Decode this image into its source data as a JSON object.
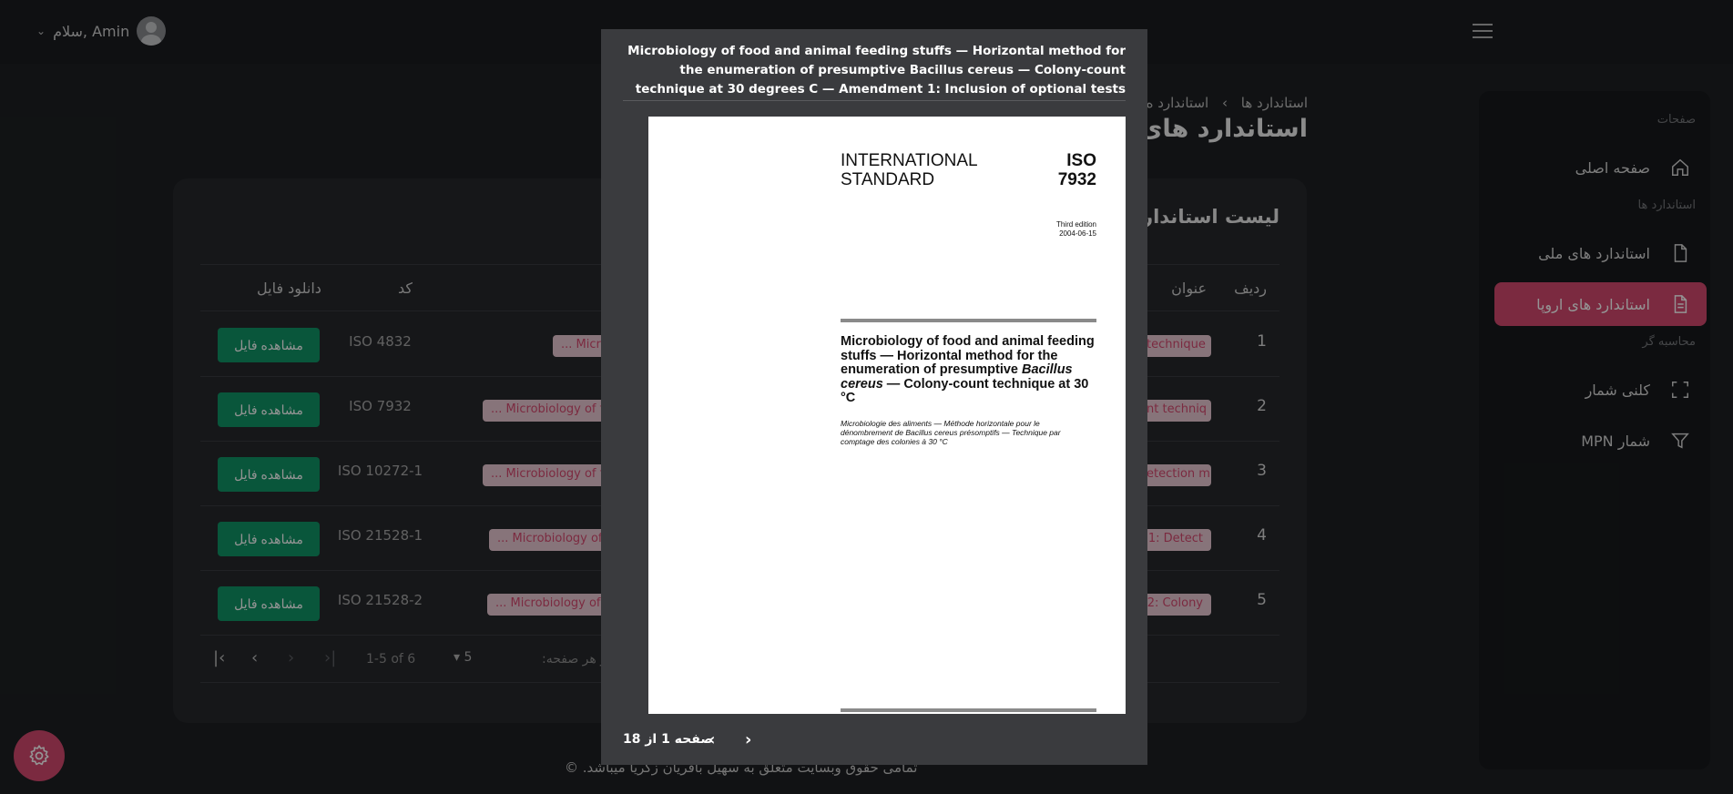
{
  "topbar": {
    "user_greeting": "سلام, Amin"
  },
  "sidebar": {
    "section_pages": "صفحات",
    "home": "صفحه اصلی",
    "section_standards": "استاندارد ها",
    "national": "استاندارد های ملی",
    "europe": "استاندارد های اروپا",
    "section_calculator": "محاسبه گر",
    "colony": "کلنی شمار",
    "mpn": "MPN شمار"
  },
  "header": {
    "crumb_root": "استاندارد ها",
    "crumb_sep": "›",
    "crumb_current": "استاندارد ه",
    "page_title": "استاندارد های اروپا"
  },
  "table": {
    "title": "لیست استاندارد ها",
    "columns": {
      "index": "ردیف",
      "title": "عنوان",
      "code": "کد",
      "download": "دانلود فایل"
    },
    "view_label": "مشاهده فایل",
    "rows": [
      {
        "index": "1",
        "title_chip": "technique",
        "desc_chip": "... Microb",
        "code": "ISO 4832"
      },
      {
        "index": "2",
        "title_chip": "nt techniq",
        "desc_chip": "... Microbiology of food an",
        "code": "ISO 7932"
      },
      {
        "index": "3",
        "title_chip": "etection m",
        "desc_chip": "... Microbiology of food an",
        "code": "ISO 10272-1"
      },
      {
        "index": "4",
        "title_chip": "1: Detect",
        "desc_chip": "... Microbiology of food a",
        "code": "ISO 21528-1"
      },
      {
        "index": "5",
        "title_chip": "2: Colony",
        "desc_chip": "... Microbiology of food a",
        "code": "ISO 21528-2"
      }
    ]
  },
  "pager": {
    "rows_per_page_label": "سند در هر صفحه:",
    "rows_per_page": "5",
    "range": "1-5 of 6"
  },
  "footer": {
    "text": "تمامی حقوق وبسایت متعلق به سهیل بافریان زکریا میباشد. ©"
  },
  "modal": {
    "title": "Microbiology of food and animal feeding stuffs — Horizontal method for the enumeration of presumptive Bacillus cereus — Colony-count technique at 30 degrees C — Amendment 1: Inclusion of optional tests",
    "page_indicator": "صفحه 1 از 18",
    "document": {
      "standard_label_1": "INTERNATIONAL",
      "standard_label_2": "STANDARD",
      "iso": "ISO",
      "number": "7932",
      "edition": "Third edition",
      "date": "2004-06-15",
      "title_part1": "Microbiology of food and animal feeding stuffs — Horizontal method for the enumeration of presumptive ",
      "title_italic": "Bacillus cereus",
      "title_part2": " — Colony-count technique at 30 °C",
      "title_fr": "Microbiologie des aliments — Méthode horizontale pour le dénombrement de Bacillus cereus présomptifs — Technique par comptage des colonies à 30 °C"
    }
  },
  "colors": {
    "accent": "#d5496f",
    "button": "#119467",
    "chip_bg": "#e9c9d3"
  }
}
